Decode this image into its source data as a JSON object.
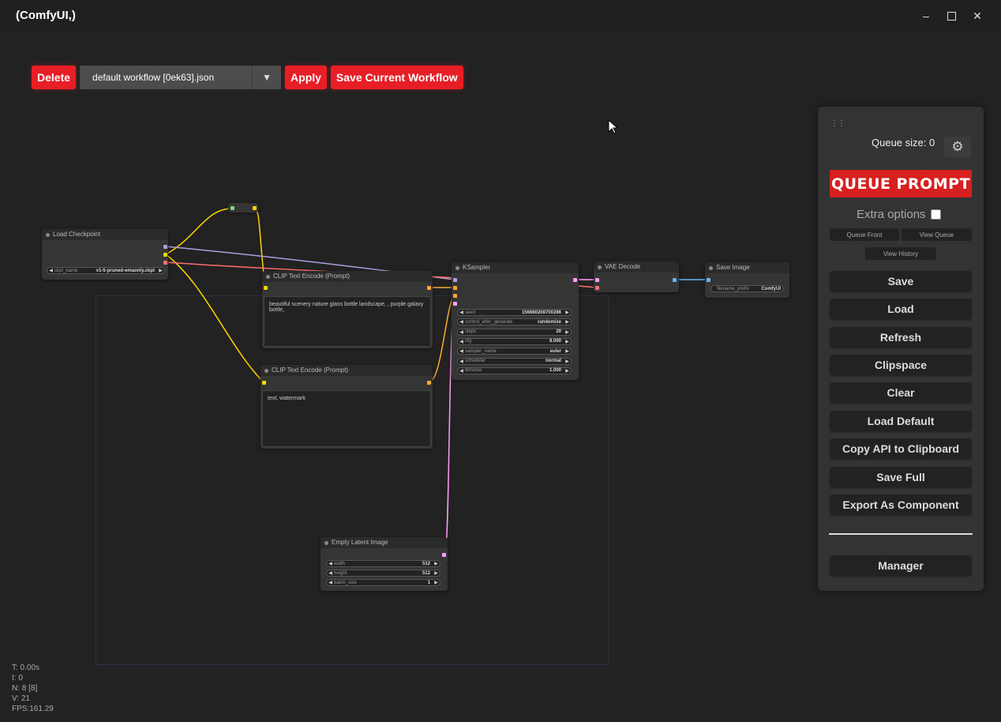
{
  "window": {
    "title": "(ComfyUI,)",
    "controls": [
      "minimize-icon",
      "maximize-icon",
      "close-icon"
    ]
  },
  "workflow": {
    "delete_label": "Delete",
    "selected": "default workflow [0ek63].json",
    "apply_label": "Apply",
    "save_label": "Save Current Workflow"
  },
  "nodes": {
    "load_checkpoint": {
      "title": "Load Checkpoint",
      "widget_label": "ckpt_name",
      "widget_value": "v1-5-pruned-emaonly.ckpt"
    },
    "clip_pos": {
      "title": "CLIP Text Encode (Prompt)",
      "text": "beautiful scenery nature glass bottle landscape, , purple galaxy bottle,"
    },
    "clip_neg": {
      "title": "CLIP Text Encode (Prompt)",
      "text": "text, watermark"
    },
    "ksampler": {
      "title": "KSampler",
      "widgets": [
        {
          "label": "seed",
          "value": "156680208700286"
        },
        {
          "label": "control_after_generate",
          "value": "randomize"
        },
        {
          "label": "steps",
          "value": "20"
        },
        {
          "label": "cfg",
          "value": "8.000"
        },
        {
          "label": "sampler_name",
          "value": "euler"
        },
        {
          "label": "scheduler",
          "value": "normal"
        },
        {
          "label": "denoise",
          "value": "1.000"
        }
      ]
    },
    "vae_decode": {
      "title": "VAE Decode"
    },
    "save_image": {
      "title": "Save Image",
      "widget_label": "filename_prefix",
      "widget_value": "ComfyUI"
    },
    "empty_latent": {
      "title": "Empty Latent Image",
      "widgets": [
        {
          "label": "width",
          "value": "512"
        },
        {
          "label": "height",
          "value": "512"
        },
        {
          "label": "batch_size",
          "value": "1"
        }
      ]
    }
  },
  "stats": {
    "t": "T: 0.00s",
    "i": "I: 0",
    "n": "N: 8 [8]",
    "v": "V: 21",
    "fps": "FPS:161.29"
  },
  "panel": {
    "queue_size": "Queue size: 0",
    "queue_prompt": "QUEUE PROMPT",
    "extra_options": "Extra options",
    "queue_front": "Queue Front",
    "view_queue": "View Queue",
    "view_history": "View History",
    "buttons": [
      "Save",
      "Load",
      "Refresh",
      "Clipspace",
      "Clear",
      "Load Default",
      "Copy API to Clipboard",
      "Save Full",
      "Export As Component"
    ],
    "manager": "Manager"
  },
  "colors": {
    "accent_red": "#e81e26",
    "clip_link": "#ffd500",
    "model_link": "#b39ddb",
    "cond_link": "#ffa931",
    "latent_link": "#ff9cf9",
    "vae_link": "#ff6e6e",
    "image_link": "#64b5f6"
  }
}
